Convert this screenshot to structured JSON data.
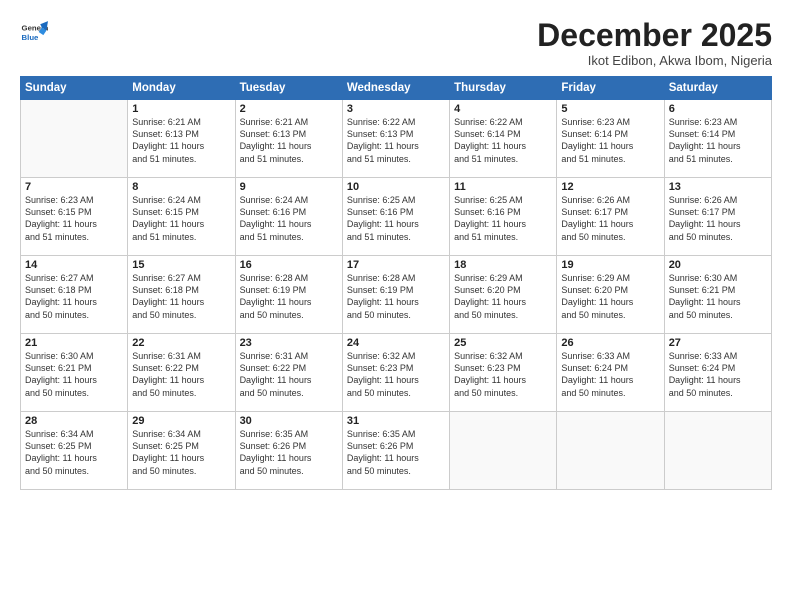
{
  "logo": {
    "general": "General",
    "blue": "Blue"
  },
  "title": "December 2025",
  "subtitle": "Ikot Edibon, Akwa Ibom, Nigeria",
  "days_header": [
    "Sunday",
    "Monday",
    "Tuesday",
    "Wednesday",
    "Thursday",
    "Friday",
    "Saturday"
  ],
  "weeks": [
    [
      {
        "day": "",
        "info": ""
      },
      {
        "day": "1",
        "info": "Sunrise: 6:21 AM\nSunset: 6:13 PM\nDaylight: 11 hours\nand 51 minutes."
      },
      {
        "day": "2",
        "info": "Sunrise: 6:21 AM\nSunset: 6:13 PM\nDaylight: 11 hours\nand 51 minutes."
      },
      {
        "day": "3",
        "info": "Sunrise: 6:22 AM\nSunset: 6:13 PM\nDaylight: 11 hours\nand 51 minutes."
      },
      {
        "day": "4",
        "info": "Sunrise: 6:22 AM\nSunset: 6:14 PM\nDaylight: 11 hours\nand 51 minutes."
      },
      {
        "day": "5",
        "info": "Sunrise: 6:23 AM\nSunset: 6:14 PM\nDaylight: 11 hours\nand 51 minutes."
      },
      {
        "day": "6",
        "info": "Sunrise: 6:23 AM\nSunset: 6:14 PM\nDaylight: 11 hours\nand 51 minutes."
      }
    ],
    [
      {
        "day": "7",
        "info": "Sunrise: 6:23 AM\nSunset: 6:15 PM\nDaylight: 11 hours\nand 51 minutes."
      },
      {
        "day": "8",
        "info": "Sunrise: 6:24 AM\nSunset: 6:15 PM\nDaylight: 11 hours\nand 51 minutes."
      },
      {
        "day": "9",
        "info": "Sunrise: 6:24 AM\nSunset: 6:16 PM\nDaylight: 11 hours\nand 51 minutes."
      },
      {
        "day": "10",
        "info": "Sunrise: 6:25 AM\nSunset: 6:16 PM\nDaylight: 11 hours\nand 51 minutes."
      },
      {
        "day": "11",
        "info": "Sunrise: 6:25 AM\nSunset: 6:16 PM\nDaylight: 11 hours\nand 51 minutes."
      },
      {
        "day": "12",
        "info": "Sunrise: 6:26 AM\nSunset: 6:17 PM\nDaylight: 11 hours\nand 50 minutes."
      },
      {
        "day": "13",
        "info": "Sunrise: 6:26 AM\nSunset: 6:17 PM\nDaylight: 11 hours\nand 50 minutes."
      }
    ],
    [
      {
        "day": "14",
        "info": "Sunrise: 6:27 AM\nSunset: 6:18 PM\nDaylight: 11 hours\nand 50 minutes."
      },
      {
        "day": "15",
        "info": "Sunrise: 6:27 AM\nSunset: 6:18 PM\nDaylight: 11 hours\nand 50 minutes."
      },
      {
        "day": "16",
        "info": "Sunrise: 6:28 AM\nSunset: 6:19 PM\nDaylight: 11 hours\nand 50 minutes."
      },
      {
        "day": "17",
        "info": "Sunrise: 6:28 AM\nSunset: 6:19 PM\nDaylight: 11 hours\nand 50 minutes."
      },
      {
        "day": "18",
        "info": "Sunrise: 6:29 AM\nSunset: 6:20 PM\nDaylight: 11 hours\nand 50 minutes."
      },
      {
        "day": "19",
        "info": "Sunrise: 6:29 AM\nSunset: 6:20 PM\nDaylight: 11 hours\nand 50 minutes."
      },
      {
        "day": "20",
        "info": "Sunrise: 6:30 AM\nSunset: 6:21 PM\nDaylight: 11 hours\nand 50 minutes."
      }
    ],
    [
      {
        "day": "21",
        "info": "Sunrise: 6:30 AM\nSunset: 6:21 PM\nDaylight: 11 hours\nand 50 minutes."
      },
      {
        "day": "22",
        "info": "Sunrise: 6:31 AM\nSunset: 6:22 PM\nDaylight: 11 hours\nand 50 minutes."
      },
      {
        "day": "23",
        "info": "Sunrise: 6:31 AM\nSunset: 6:22 PM\nDaylight: 11 hours\nand 50 minutes."
      },
      {
        "day": "24",
        "info": "Sunrise: 6:32 AM\nSunset: 6:23 PM\nDaylight: 11 hours\nand 50 minutes."
      },
      {
        "day": "25",
        "info": "Sunrise: 6:32 AM\nSunset: 6:23 PM\nDaylight: 11 hours\nand 50 minutes."
      },
      {
        "day": "26",
        "info": "Sunrise: 6:33 AM\nSunset: 6:24 PM\nDaylight: 11 hours\nand 50 minutes."
      },
      {
        "day": "27",
        "info": "Sunrise: 6:33 AM\nSunset: 6:24 PM\nDaylight: 11 hours\nand 50 minutes."
      }
    ],
    [
      {
        "day": "28",
        "info": "Sunrise: 6:34 AM\nSunset: 6:25 PM\nDaylight: 11 hours\nand 50 minutes."
      },
      {
        "day": "29",
        "info": "Sunrise: 6:34 AM\nSunset: 6:25 PM\nDaylight: 11 hours\nand 50 minutes."
      },
      {
        "day": "30",
        "info": "Sunrise: 6:35 AM\nSunset: 6:26 PM\nDaylight: 11 hours\nand 50 minutes."
      },
      {
        "day": "31",
        "info": "Sunrise: 6:35 AM\nSunset: 6:26 PM\nDaylight: 11 hours\nand 50 minutes."
      },
      {
        "day": "",
        "info": ""
      },
      {
        "day": "",
        "info": ""
      },
      {
        "day": "",
        "info": ""
      }
    ]
  ]
}
